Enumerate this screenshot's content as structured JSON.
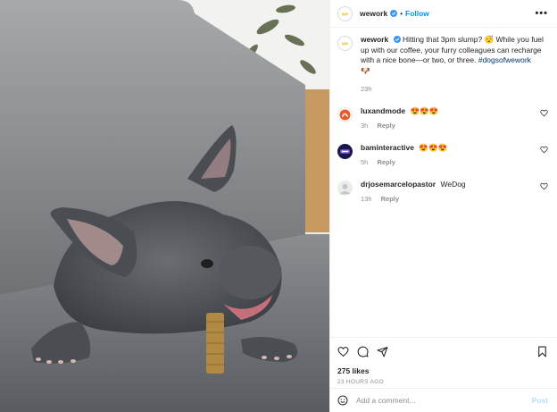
{
  "header": {
    "username": "wework",
    "separator": "•",
    "follow_label": "Follow",
    "more_label": "•••"
  },
  "caption": {
    "username": "wework",
    "text": "Hitting that 3pm slump? 😴 While you fuel up with our coffee, your furry colleagues can recharge with a nice bone—or two, or three.",
    "hashtag": "#dogsofwework",
    "trailing_emoji": "🐶",
    "time": "23h"
  },
  "comments": [
    {
      "username": "luxandmode",
      "text": "😍😍😍",
      "time": "3h",
      "reply_label": "Reply",
      "avatar_icon": "luxandmode-logo"
    },
    {
      "username": "bаminteractive",
      "text": "😍😍😍",
      "time": "5h",
      "reply_label": "Reply",
      "avatar_icon": "bam-logo"
    },
    {
      "username": "drjosemarcelopastor",
      "text": "WeDog",
      "time": "13h",
      "reply_label": "Reply",
      "avatar_icon": "default-avatar"
    }
  ],
  "actions": {
    "likes": "275 likes",
    "time_ago": "23 HOURS AGO",
    "icons": [
      "heart-icon",
      "comment-icon",
      "share-icon",
      "bookmark-icon"
    ]
  },
  "add_comment": {
    "placeholder": "Add a comment...",
    "post_label": "Post"
  },
  "colors": {
    "link_blue": "#0095f6",
    "post_disabled": "#b2dffc",
    "secondary_text": "#8e8e8e",
    "hashtag": "#00376b",
    "brand_yellow": "#f5b400"
  }
}
